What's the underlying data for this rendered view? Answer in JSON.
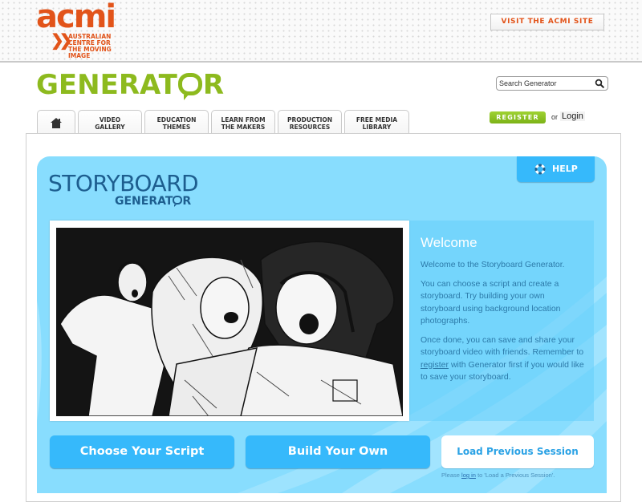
{
  "header": {
    "brand": {
      "name": "acmi",
      "tagline_lines": [
        "AUSTRALIAN",
        "CENTRE FOR",
        "THE MOVING",
        "IMAGE"
      ],
      "color": "#e2541a"
    },
    "visit_button_label": "VISIT THE ACMI SITE"
  },
  "site": {
    "logo_text_before": "GENERAT",
    "logo_text_after": "R",
    "logo_color": "#8dba1e"
  },
  "search": {
    "placeholder": "Search Generator",
    "value": ""
  },
  "nav": {
    "tabs": [
      {
        "label": "Home",
        "icon": "home-icon"
      },
      {
        "line1": "VIDEO",
        "line2": "GALLERY"
      },
      {
        "line1": "EDUCATION",
        "line2": "THEMES"
      },
      {
        "line1": "LEARN FROM",
        "line2": "THE MAKERS"
      },
      {
        "line1": "PRODUCTION",
        "line2": "RESOURCES"
      },
      {
        "line1": "FREE MEDIA",
        "line2": "LIBRARY"
      }
    ]
  },
  "account": {
    "register_label": "REGISTER",
    "or_text": "or",
    "login_label": "Login"
  },
  "storyboard": {
    "title": "STORYBOARD",
    "subtitle_before": "GENERAT",
    "subtitle_after": "R",
    "help_label": "HELP",
    "image_alt": "Comic illustration of three frightened people running",
    "welcome": {
      "title": "Welcome",
      "p1": "Welcome to the Storyboard Generator.",
      "p2": "You can choose a script and create a storyboard. Try building your own storyboard using background location photographs.",
      "p3_before": "Once done, you can save and share your storyboard video with friends. Remember to",
      "p3_link": "register",
      "p3_after": "with Generator first if you would like to save your storyboard."
    },
    "actions": {
      "choose_script": "Choose Your Script",
      "build_own": "Build Your Own",
      "load_session": "Load Previous Session"
    },
    "session_note": {
      "before": "Please",
      "link": "log in",
      "after": "to 'Load a Previous Session'."
    }
  },
  "colors": {
    "panel_bg": "#88ddfe",
    "button_blue": "#36b9fb",
    "title_navy": "#1d5e8f",
    "register_green": "#8dba1e"
  }
}
